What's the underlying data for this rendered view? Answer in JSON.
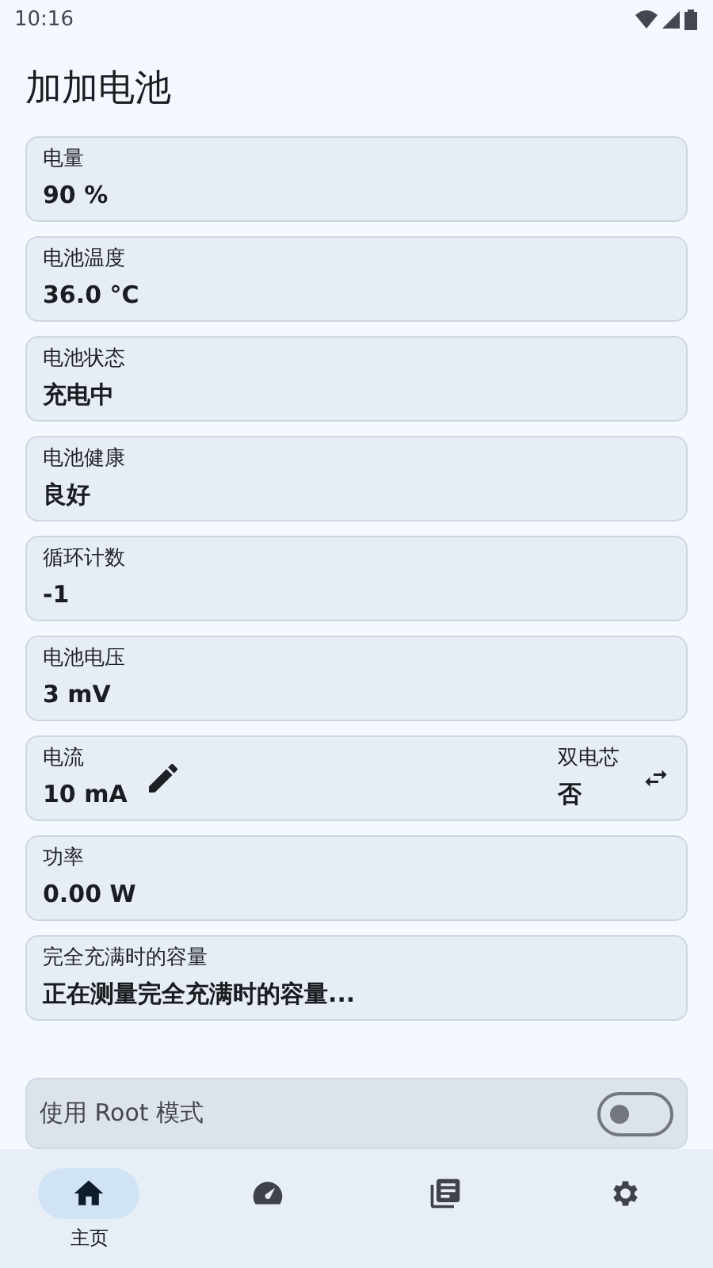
{
  "status_bar": {
    "time": "10:16"
  },
  "app_bar": {
    "title": "加加电池"
  },
  "cards": [
    {
      "kind": "plain",
      "label": "电量",
      "value": "90 %"
    },
    {
      "kind": "plain",
      "label": "电池温度",
      "value": "36.0 °C"
    },
    {
      "kind": "plain",
      "label": "电池状态",
      "value": "充电中"
    },
    {
      "kind": "plain",
      "label": "电池健康",
      "value": "良好"
    },
    {
      "kind": "plain",
      "label": "循环计数",
      "value": "-1"
    },
    {
      "kind": "plain",
      "label": "电池电压",
      "value": "3 mV"
    },
    {
      "kind": "split",
      "label": "电流",
      "value": "10 mA",
      "right_label": "双电芯",
      "right_value": "否"
    },
    {
      "kind": "plain",
      "label": "功率",
      "value": "0.00 W"
    },
    {
      "kind": "plain",
      "label": "完全充满时的容量",
      "value": "正在测量完全充满时的容量..."
    }
  ],
  "root_mode": {
    "label": "使用 Root 模式",
    "on": false
  },
  "nav": [
    {
      "kind": "home",
      "label": "主页",
      "selected": true
    },
    {
      "kind": "gauge",
      "selected": false
    },
    {
      "kind": "library",
      "selected": false
    },
    {
      "kind": "settings",
      "selected": false
    }
  ]
}
